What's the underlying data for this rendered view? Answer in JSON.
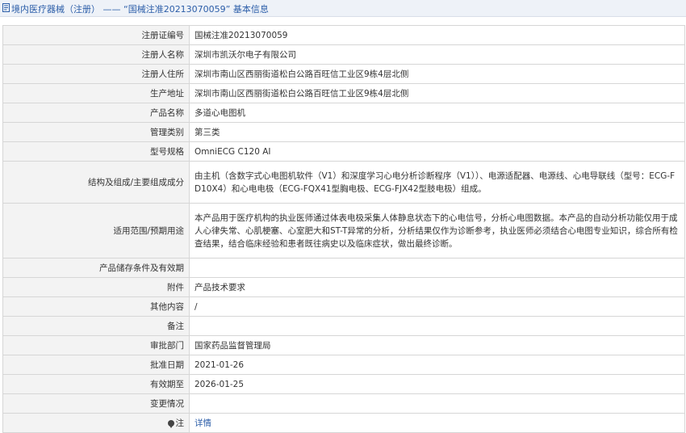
{
  "header": {
    "title": "境内医疗器械（注册） —— “国械注准20213070059” 基本信息"
  },
  "rows": [
    {
      "label": "注册证编号",
      "value": "国械注准20213070059"
    },
    {
      "label": "注册人名称",
      "value": "深圳市凯沃尔电子有限公司"
    },
    {
      "label": "注册人住所",
      "value": "深圳市南山区西丽街道松白公路百旺信工业区9栋4层北侧"
    },
    {
      "label": "生产地址",
      "value": "深圳市南山区西丽街道松白公路百旺信工业区9栋4层北侧"
    },
    {
      "label": "产品名称",
      "value": "多道心电图机"
    },
    {
      "label": "管理类别",
      "value": "第三类"
    },
    {
      "label": "型号规格",
      "value": "OmniECG C120 AI"
    },
    {
      "label": "结构及组成/主要组成成分",
      "value": "由主机（含数字式心电图机软件（V1）和深度学习心电分析诊断程序（V1））、电源适配器、电源线、心电导联线（型号：ECG-FD10X4）和心电电极（ECG-FQX41型胸电极、ECG-FJX42型肢电极）组成。"
    },
    {
      "label": "适用范围/预期用途",
      "value": "本产品用于医疗机构的执业医师通过体表电极采集人体静息状态下的心电信号，分析心电图数据。本产品的自动分析功能仅用于成人心律失常、心肌梗塞、心室肥大和ST-T异常的分析，分析结果仅作为诊断参考，执业医师必须结合心电图专业知识，综合所有检查结果，结合临床经验和患者既往病史以及临床症状，做出最终诊断。"
    },
    {
      "label": "产品储存条件及有效期",
      "value": ""
    },
    {
      "label": "附件",
      "value": "产品技术要求"
    },
    {
      "label": "其他内容",
      "value": "/"
    },
    {
      "label": "备注",
      "value": ""
    },
    {
      "label": "审批部门",
      "value": "国家药品监督管理局"
    },
    {
      "label": "批准日期",
      "value": "2021-01-26"
    },
    {
      "label": "有效期至",
      "value": "2026-01-25"
    },
    {
      "label": "变更情况",
      "value": ""
    }
  ],
  "note_row": {
    "label": "注",
    "link_label": "详情"
  },
  "icons": {
    "title": "document-icon",
    "note": "pin-icon"
  },
  "colors": {
    "title_text": "#2b5da8",
    "label_bg": "#f3f3f3",
    "header_bg": "#eef2f8",
    "link": "#2b5da8"
  }
}
